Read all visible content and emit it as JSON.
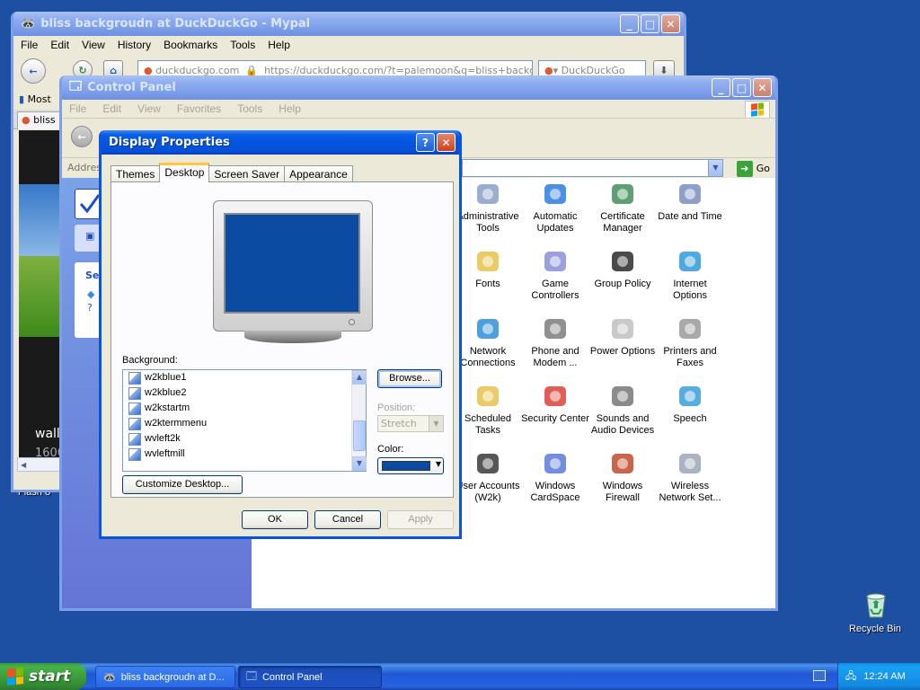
{
  "browser": {
    "title": "bliss backgroudn at DuckDuckGo - Mypal",
    "menu": [
      "File",
      "Edit",
      "View",
      "History",
      "Bookmarks",
      "Tools",
      "Help"
    ],
    "url_text": "duckduckgo.com",
    "url_full": "https://duckduckgo.com/?t=palemoon&q=bliss+backg",
    "search_text": "DuckDuckGo",
    "bookmarks_label": "Most",
    "tab_label": "bliss b",
    "page_text1": "wallp",
    "page_text2": "1600"
  },
  "control_panel": {
    "title": "Control Panel",
    "menu": [
      "File",
      "Edit",
      "View",
      "Favorites",
      "Tools",
      "Help"
    ],
    "address_label": "Address",
    "go_label": "Go",
    "side_heading": "Se",
    "items": [
      {
        "label": "Administrative Tools",
        "icon": "admin-tools-icon"
      },
      {
        "label": "Automatic Updates",
        "icon": "automatic-updates-icon"
      },
      {
        "label": "Certificate Manager",
        "icon": "certificate-icon"
      },
      {
        "label": "Date and Time",
        "icon": "clock-icon"
      },
      {
        "label": "Fonts",
        "icon": "fonts-folder-icon"
      },
      {
        "label": "Game Controllers",
        "icon": "gamepad-icon"
      },
      {
        "label": "Group Policy",
        "icon": "group-policy-icon"
      },
      {
        "label": "Internet Options",
        "icon": "globe-icon"
      },
      {
        "label": "Network Connections",
        "icon": "network-icon"
      },
      {
        "label": "Phone and Modem ...",
        "icon": "phone-icon"
      },
      {
        "label": "Power Options",
        "icon": "power-icon"
      },
      {
        "label": "Printers and Faxes",
        "icon": "printer-icon"
      },
      {
        "label": "Scheduled Tasks",
        "icon": "scheduled-tasks-icon"
      },
      {
        "label": "Security Center",
        "icon": "shield-icon"
      },
      {
        "label": "Sounds and Audio Devices",
        "icon": "speaker-icon"
      },
      {
        "label": "Speech",
        "icon": "speech-icon"
      },
      {
        "label": "User Accounts (W2k)",
        "icon": "user-accounts-icon"
      },
      {
        "label": "Windows CardSpace",
        "icon": "cardspace-icon"
      },
      {
        "label": "Windows Firewall",
        "icon": "firewall-icon"
      },
      {
        "label": "Wireless Network Set...",
        "icon": "wireless-icon"
      }
    ]
  },
  "display_properties": {
    "title": "Display Properties",
    "help_btn": "?",
    "tabs": [
      "Themes",
      "Desktop",
      "Screen Saver",
      "Appearance"
    ],
    "active_tab": "Desktop",
    "background_label": "Background:",
    "backgrounds": [
      "w2kblue1",
      "w2kblue2",
      "w2kstartm",
      "w2ktermmenu",
      "wvleft2k",
      "wvleftmill"
    ],
    "browse_label": "Browse...",
    "position_label": "Position:",
    "position_value": "Stretch",
    "color_label": "Color:",
    "color_value": "#0c4ba2",
    "customize_label": "Customize Desktop...",
    "ok_label": "OK",
    "cancel_label": "Cancel",
    "apply_label": "Apply"
  },
  "desktop": {
    "recycle_bin": "Recycle Bin",
    "label_flash": "Flash 8"
  },
  "taskbar": {
    "start_label": "start",
    "tasks": [
      "bliss backgroudn at D...",
      "Control Panel"
    ],
    "clock": "12:24 AM"
  }
}
